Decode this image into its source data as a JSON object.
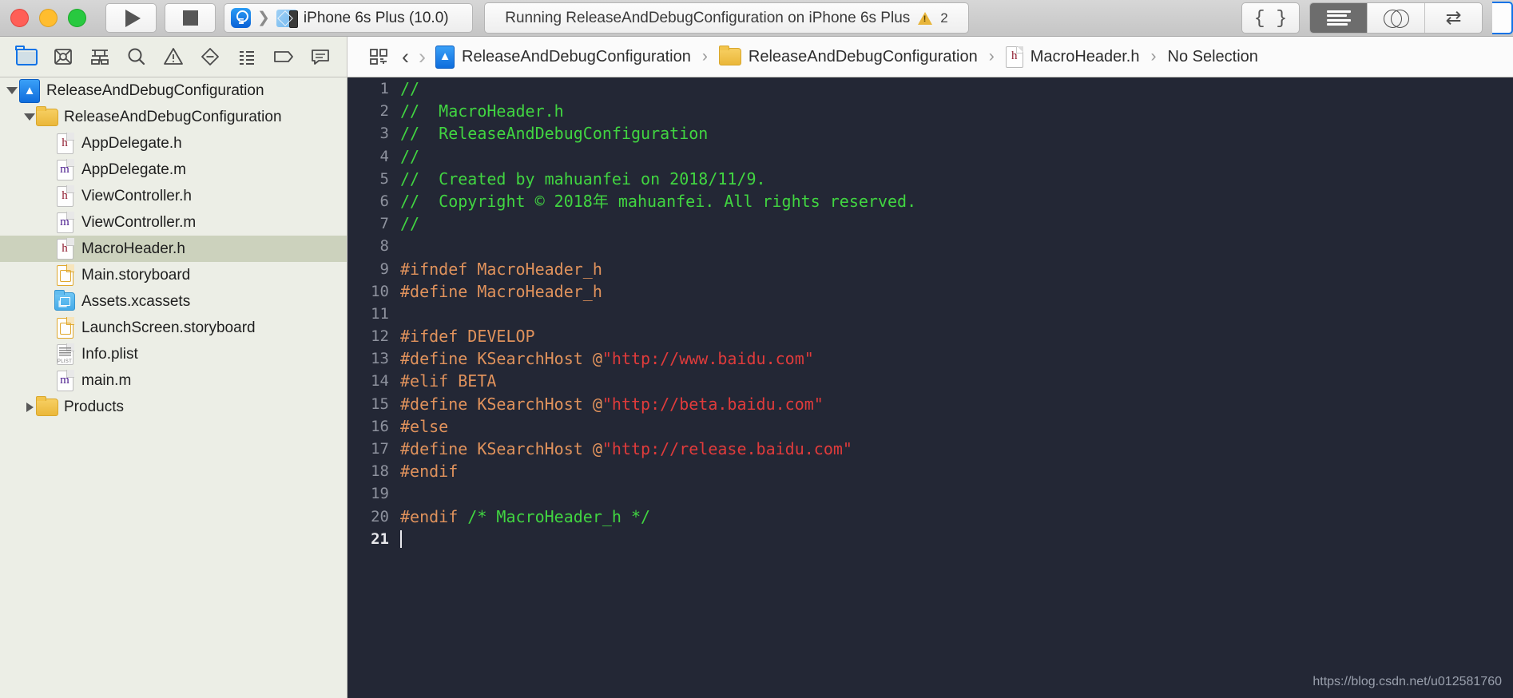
{
  "titlebar": {
    "window_controls": [
      "close",
      "minimize",
      "zoom"
    ],
    "run_button": "run-button",
    "stop_button": "stop-button",
    "scheme": {
      "scheme_name": "ReleaseAndDebugConfiguration",
      "destination": "iPhone 6s Plus (10.0)"
    },
    "status": {
      "message": "Running ReleaseAndDebugConfiguration on iPhone 6s Plus",
      "warning_count": "2"
    },
    "right_buttons": [
      {
        "name": "code-snippets-button",
        "glyph": "{ }"
      },
      {
        "name": "standard-editor-button",
        "glyph": "lines"
      },
      {
        "name": "assistant-editor-button",
        "glyph": "venn"
      },
      {
        "name": "version-editor-button",
        "glyph": "swap-arrows"
      }
    ]
  },
  "navigator_toolbar": {
    "icons": [
      "project-navigator-icon",
      "source-control-navigator-icon",
      "symbol-navigator-icon",
      "find-navigator-icon",
      "issue-navigator-icon",
      "test-navigator-icon",
      "debug-navigator-icon",
      "breakpoint-navigator-icon",
      "report-navigator-icon"
    ]
  },
  "editor_toolbar": {
    "related_items_icon": "related-items-icon",
    "back_arrow": "‹",
    "forward_arrow": "›",
    "breadcrumb": [
      {
        "label": "ReleaseAndDebugConfiguration",
        "icon": "app-project-icon"
      },
      {
        "label": "ReleaseAndDebugConfiguration",
        "icon": "folder-icon"
      },
      {
        "label": "MacroHeader.h",
        "icon": "header-file-icon"
      },
      {
        "label": "No Selection",
        "icon": "none"
      }
    ],
    "separator": "›"
  },
  "sidebar": {
    "items": [
      {
        "label": "ReleaseAndDebugConfiguration",
        "icon": "app-project-icon",
        "indent": 0,
        "twisty": "down",
        "selected": false
      },
      {
        "label": "ReleaseAndDebugConfiguration",
        "icon": "folder-icon",
        "indent": 1,
        "twisty": "down",
        "selected": false
      },
      {
        "label": "AppDelegate.h",
        "icon": "h-file-icon",
        "indent": 2,
        "twisty": "none",
        "selected": false
      },
      {
        "label": "AppDelegate.m",
        "icon": "m-file-icon",
        "indent": 2,
        "twisty": "none",
        "selected": false
      },
      {
        "label": "ViewController.h",
        "icon": "h-file-icon",
        "indent": 2,
        "twisty": "none",
        "selected": false
      },
      {
        "label": "ViewController.m",
        "icon": "m-file-icon",
        "indent": 2,
        "twisty": "none",
        "selected": false
      },
      {
        "label": "MacroHeader.h",
        "icon": "h-file-icon",
        "indent": 2,
        "twisty": "none",
        "selected": true
      },
      {
        "label": "Main.storyboard",
        "icon": "storyboard-icon",
        "indent": 2,
        "twisty": "none",
        "selected": false
      },
      {
        "label": "Assets.xcassets",
        "icon": "xcassets-icon",
        "indent": 2,
        "twisty": "none",
        "selected": false
      },
      {
        "label": "LaunchScreen.storyboard",
        "icon": "storyboard-icon",
        "indent": 2,
        "twisty": "none",
        "selected": false
      },
      {
        "label": "Info.plist",
        "icon": "plist-icon",
        "indent": 2,
        "twisty": "none",
        "selected": false
      },
      {
        "label": "main.m",
        "icon": "m-file-icon",
        "indent": 2,
        "twisty": "none",
        "selected": false
      },
      {
        "label": "Products",
        "icon": "folder-icon",
        "indent": 1,
        "twisty": "right",
        "selected": false
      }
    ]
  },
  "editor": {
    "filename": "MacroHeader.h",
    "cursor_line": 21,
    "colors": {
      "background": "#232735",
      "comment": "#41d541",
      "preprocessor": "#e0925c",
      "string": "#e03b3b",
      "plain": "#d8dae0",
      "gutter": "#8e929e"
    },
    "lines": [
      {
        "n": "1",
        "tokens": [
          {
            "t": "//",
            "c": "comment"
          }
        ]
      },
      {
        "n": "2",
        "tokens": [
          {
            "t": "//  MacroHeader.h",
            "c": "comment"
          }
        ]
      },
      {
        "n": "3",
        "tokens": [
          {
            "t": "//  ReleaseAndDebugConfiguration",
            "c": "comment"
          }
        ]
      },
      {
        "n": "4",
        "tokens": [
          {
            "t": "//",
            "c": "comment"
          }
        ]
      },
      {
        "n": "5",
        "tokens": [
          {
            "t": "//  Created by mahuanfei on 2018/11/9.",
            "c": "comment"
          }
        ]
      },
      {
        "n": "6",
        "tokens": [
          {
            "t": "//  Copyright © 2018年 mahuanfei. All rights reserved.",
            "c": "comment"
          }
        ]
      },
      {
        "n": "7",
        "tokens": [
          {
            "t": "//",
            "c": "comment"
          }
        ]
      },
      {
        "n": "8",
        "tokens": []
      },
      {
        "n": "9",
        "tokens": [
          {
            "t": "#ifndef MacroHeader_h",
            "c": "pre"
          }
        ]
      },
      {
        "n": "10",
        "tokens": [
          {
            "t": "#define MacroHeader_h",
            "c": "pre"
          }
        ]
      },
      {
        "n": "11",
        "tokens": []
      },
      {
        "n": "12",
        "tokens": [
          {
            "t": "#ifdef DEVELOP",
            "c": "pre"
          }
        ]
      },
      {
        "n": "13",
        "tokens": [
          {
            "t": "#define KSearchHost @",
            "c": "pre"
          },
          {
            "t": "\"http://www.baidu.com\"",
            "c": "str"
          }
        ]
      },
      {
        "n": "14",
        "tokens": [
          {
            "t": "#elif BETA",
            "c": "pre"
          }
        ]
      },
      {
        "n": "15",
        "tokens": [
          {
            "t": "#define KSearchHost @",
            "c": "pre"
          },
          {
            "t": "\"http://beta.baidu.com\"",
            "c": "str"
          }
        ]
      },
      {
        "n": "16",
        "tokens": [
          {
            "t": "#else",
            "c": "pre"
          }
        ]
      },
      {
        "n": "17",
        "tokens": [
          {
            "t": "#define KSearchHost @",
            "c": "pre"
          },
          {
            "t": "\"http://release.baidu.com\"",
            "c": "str"
          }
        ]
      },
      {
        "n": "18",
        "tokens": [
          {
            "t": "#endif",
            "c": "pre"
          }
        ]
      },
      {
        "n": "19",
        "tokens": []
      },
      {
        "n": "20",
        "tokens": [
          {
            "t": "#endif ",
            "c": "pre"
          },
          {
            "t": "/* MacroHeader_h */",
            "c": "comment"
          }
        ]
      },
      {
        "n": "21",
        "tokens": [],
        "cursor": true
      }
    ]
  },
  "watermark": "https://blog.csdn.net/u012581760"
}
